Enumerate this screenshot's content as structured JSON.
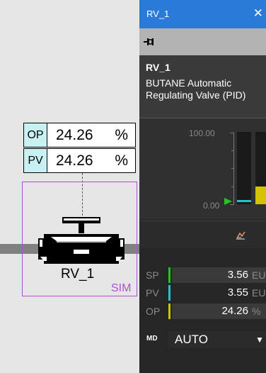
{
  "diagram": {
    "op_box": {
      "label": "OP",
      "value": "24.26",
      "unit": "%"
    },
    "pv_box": {
      "label": "PV",
      "value": "24.26",
      "unit": "%"
    },
    "valve_name": "RV_1",
    "sim_badge": "SIM",
    "icon": "control-valve-icon"
  },
  "faceplate": {
    "window_title": "RV_1",
    "close_icon": "close-icon",
    "pin_icon": "pin-icon",
    "tag": "RV_1",
    "description": "BUTANE Automatic Regulating Valve (PID)",
    "scale_high": "100.00",
    "scale_low": "0.00",
    "pv_level_percent": 3.55,
    "op_level_percent": 24.26,
    "sp_level_percent": 3.56,
    "trend_icon": "trend-icon",
    "params": {
      "sp": {
        "name": "SP",
        "value": "3.56",
        "unit": "EU"
      },
      "pv": {
        "name": "PV",
        "value": "3.55",
        "unit": "EU"
      },
      "op": {
        "name": "OP",
        "value": "24.26",
        "unit": "%"
      }
    },
    "mode": {
      "label": "MD",
      "value": "AUTO",
      "chevron_icon": "chevron-down-icon"
    },
    "colors": {
      "titlebar": "#2a7ad8",
      "sp": "#22c522",
      "pv": "#1cc6d8",
      "op": "#d4c200",
      "sim": "#b04fd6"
    }
  }
}
